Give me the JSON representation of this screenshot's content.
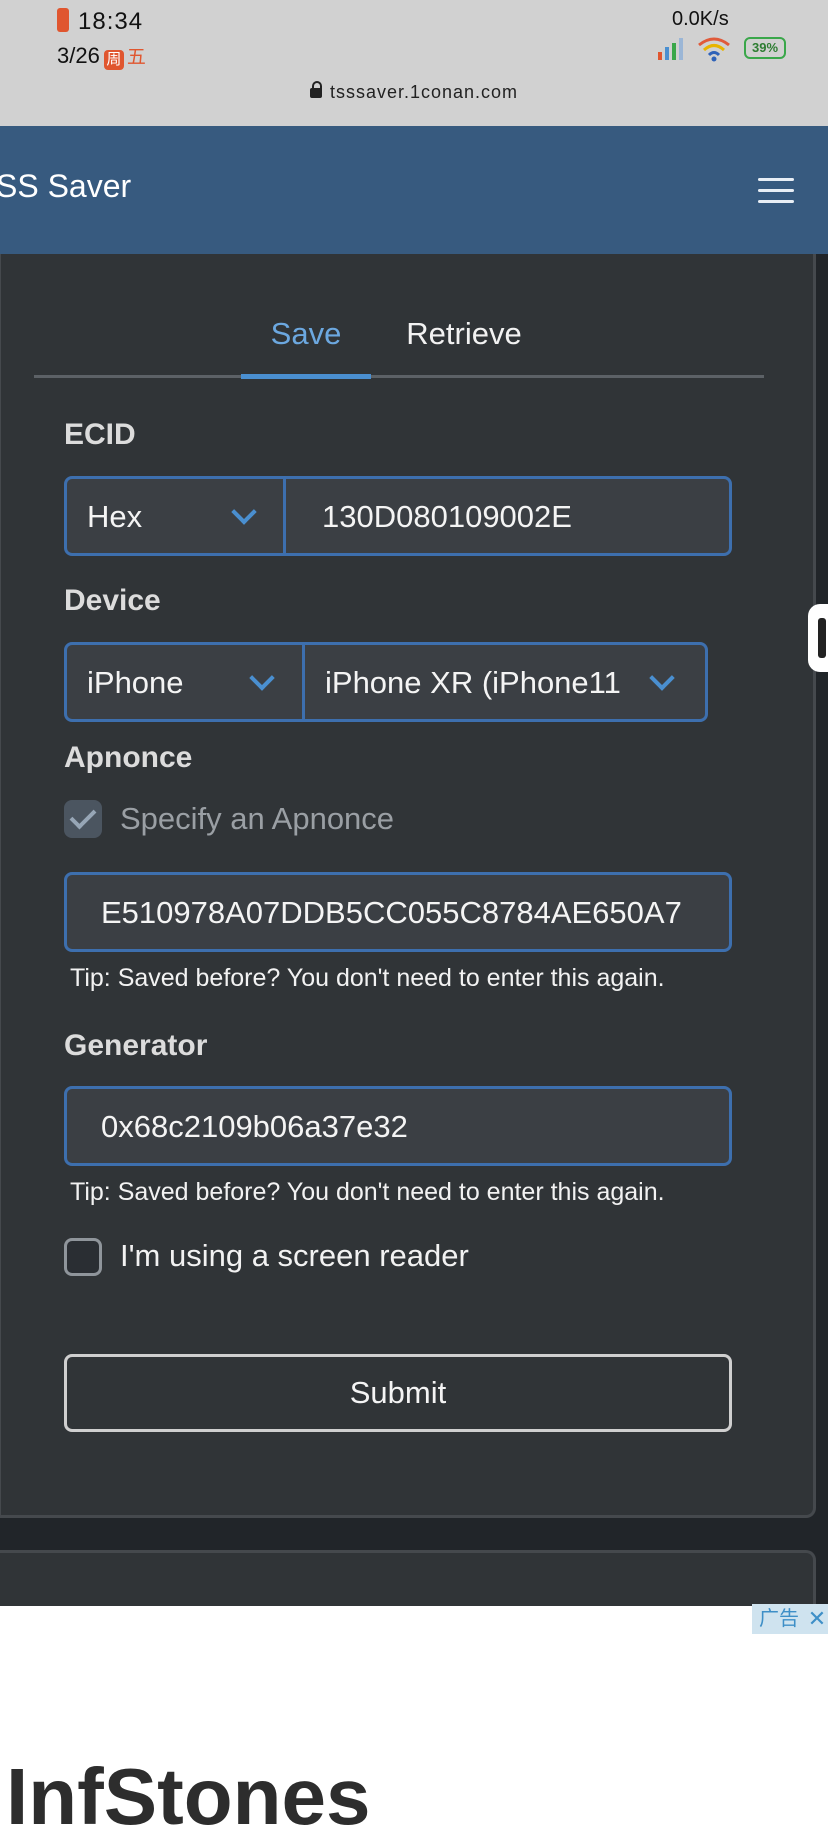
{
  "status_bar": {
    "time": "18:34",
    "date": "3/26",
    "weekday_badge": "周",
    "weekday": "五",
    "net_speed": "0.0K/s",
    "battery": "39%",
    "url": "tsssaver.1conan.com"
  },
  "navbar": {
    "brand": "SS Saver"
  },
  "tabs": [
    {
      "label": "Save",
      "active": true
    },
    {
      "label": "Retrieve",
      "active": false
    }
  ],
  "form": {
    "ecid": {
      "label": "ECID",
      "format_select": "Hex",
      "value": "130D080109002E"
    },
    "device": {
      "label": "Device",
      "type_select": "iPhone",
      "model_select": "iPhone XR (iPhone11"
    },
    "apnonce": {
      "label": "Apnonce",
      "checkbox_label": "Specify an Apnonce",
      "checked": true,
      "value": "E510978A07DDB5CC055C8784AE650A7",
      "tip": "Tip: Saved before? You don't need to enter this again."
    },
    "generator": {
      "label": "Generator",
      "value": "0x68c2109b06a37e32",
      "tip": "Tip: Saved before? You don't need to enter this again."
    },
    "screen_reader": {
      "label": "I'm using a screen reader",
      "checked": false
    },
    "submit_label": "Submit"
  },
  "ad": {
    "badge": "广告",
    "close": "✕",
    "heading": "InfStones"
  },
  "colors": {
    "navbar": "#375a7f",
    "accent": "#4a8fd0",
    "panel": "#303437",
    "background": "#212529"
  }
}
